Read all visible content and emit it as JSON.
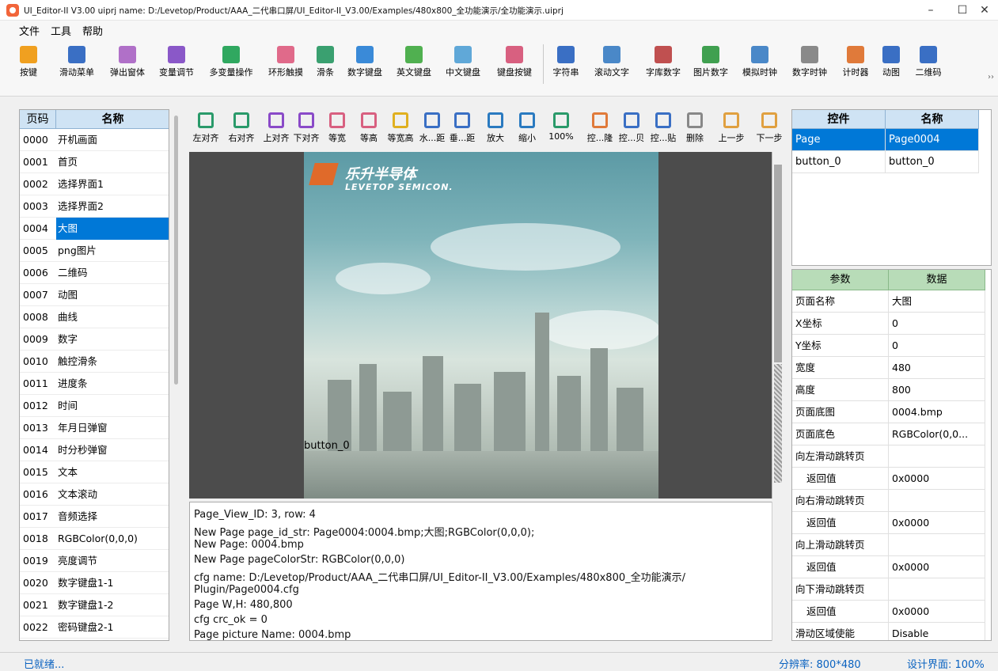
{
  "title": "UI_Editor-II V3.00  uiprj name: D:/Levetop/Product/AAA_二代串口屏/UI_Editor-II_V3.00/Examples/480x800_全功能演示/全功能演示.uiprj",
  "window_controls": {
    "minimize": "–",
    "maximize": "☐",
    "close": "✕"
  },
  "menu": [
    "文件",
    "工具",
    "帮助"
  ],
  "toolbar": [
    {
      "label": "按键",
      "color": "#f0a020"
    },
    {
      "label": "滑动菜单",
      "color": "#3a6fc4"
    },
    {
      "label": "弹出窗体",
      "color": "#b070c8"
    },
    {
      "label": "变量调节",
      "color": "#8a58c8"
    },
    {
      "label": "多变量操作",
      "color": "#30a860"
    },
    {
      "label": "环形触摸",
      "color": "#e06a8a"
    },
    {
      "label": "滑条",
      "color": "#3aa070"
    },
    {
      "label": "数字键盘",
      "color": "#3a8ad8"
    },
    {
      "label": "英文键盘",
      "color": "#50b050"
    },
    {
      "label": "中文键盘",
      "color": "#60a8d8"
    },
    {
      "label": "键盘按键",
      "color": "#d86080"
    },
    {
      "label": "字符串",
      "color": "#3a6fc4"
    },
    {
      "label": "滚动文字",
      "color": "#4a88c8"
    },
    {
      "label": "字库数字",
      "color": "#c05050"
    },
    {
      "label": "图片数字",
      "color": "#40a050"
    },
    {
      "label": "模拟时钟",
      "color": "#4a88c8"
    },
    {
      "label": "数字时钟",
      "color": "#8a8a8a"
    },
    {
      "label": "计时器",
      "color": "#e07a3a"
    },
    {
      "label": "动图",
      "color": "#3a6fc4"
    },
    {
      "label": "二维码",
      "color": "#3a6fc4"
    }
  ],
  "toolbar_more": "››",
  "pages": {
    "header": {
      "code": "页码",
      "name": "名称"
    },
    "rows": [
      {
        "num": "0000",
        "name": "开机画面"
      },
      {
        "num": "0001",
        "name": "首页"
      },
      {
        "num": "0002",
        "name": "选择界面1"
      },
      {
        "num": "0003",
        "name": "选择界面2"
      },
      {
        "num": "0004",
        "name": "大图"
      },
      {
        "num": "0005",
        "name": "png图片"
      },
      {
        "num": "0006",
        "name": "二维码"
      },
      {
        "num": "0007",
        "name": "动图"
      },
      {
        "num": "0008",
        "name": "曲线"
      },
      {
        "num": "0009",
        "name": "数字"
      },
      {
        "num": "0010",
        "name": "触控滑条"
      },
      {
        "num": "0011",
        "name": "进度条"
      },
      {
        "num": "0012",
        "name": "时间"
      },
      {
        "num": "0013",
        "name": "年月日弹窗"
      },
      {
        "num": "0014",
        "name": "时分秒弹窗"
      },
      {
        "num": "0015",
        "name": "文本"
      },
      {
        "num": "0016",
        "name": "文本滚动"
      },
      {
        "num": "0017",
        "name": "音频选择"
      },
      {
        "num": "0018",
        "name": "RGBColor(0,0,0)"
      },
      {
        "num": "0019",
        "name": "亮度调节"
      },
      {
        "num": "0020",
        "name": "数字键盘1-1"
      },
      {
        "num": "0021",
        "name": "数字键盘1-2"
      },
      {
        "num": "0022",
        "name": "密码键盘2-1"
      }
    ]
  },
  "canvas_tools": [
    {
      "label": "左对齐"
    },
    {
      "label": "右对齐"
    },
    {
      "label": "上对齐"
    },
    {
      "label": "下对齐"
    },
    {
      "label": "等宽"
    },
    {
      "label": "等高"
    },
    {
      "label": "等宽高"
    },
    {
      "label": "水...距"
    },
    {
      "label": "垂...距"
    },
    {
      "label": "放大"
    },
    {
      "label": "缩小"
    },
    {
      "label": "100%"
    },
    {
      "label": "控...隆"
    },
    {
      "label": "控...贝"
    },
    {
      "label": "控...贴"
    },
    {
      "label": "删除"
    },
    {
      "label": "上一步"
    },
    {
      "label": "下一步"
    }
  ],
  "canvas": {
    "logo_cn": "乐升半导体",
    "logo_en": "LEVETOP SEMICON.",
    "button_label": "button_0"
  },
  "log": [
    "Page_View_ID: 3, row: 4",
    "New Page page_id_str: Page0004:0004.bmp;大图;RGBColor(0,0,0);",
    "New Page: 0004.bmp",
    "New Page pageColorStr: RGBColor(0,0,0)",
    "cfg name: D:/Levetop/Product/AAA_二代串口屏/UI_Editor-II_V3.00/Examples/480x800_全功能演示/",
    "Plugin/Page0004.cfg",
    "Page W,H: 480,800",
    "cfg crc_ok = 0",
    "Page picture Name: 0004.bmp"
  ],
  "controls": {
    "header": {
      "control": "控件",
      "name": "名称"
    },
    "rows": [
      {
        "control": "Page",
        "name": "Page0004"
      },
      {
        "control": "button_0",
        "name": "button_0"
      }
    ]
  },
  "params": {
    "header": {
      "param": "参数",
      "data": "数据"
    },
    "rows": [
      {
        "param": "页面名称",
        "data": "大图"
      },
      {
        "param": "X坐标",
        "data": "0"
      },
      {
        "param": "Y坐标",
        "data": "0"
      },
      {
        "param": "宽度",
        "data": "480"
      },
      {
        "param": "高度",
        "data": "800"
      },
      {
        "param": "页面底图",
        "data": "0004.bmp"
      },
      {
        "param": "页面底色",
        "data": "RGBColor(0,0..."
      },
      {
        "param": "向左滑动跳转页",
        "data": ""
      },
      {
        "param": "返回值",
        "data": "0x0000"
      },
      {
        "param": "向右滑动跳转页",
        "data": ""
      },
      {
        "param": "返回值",
        "data": "0x0000"
      },
      {
        "param": "向上滑动跳转页",
        "data": ""
      },
      {
        "param": "返回值",
        "data": "0x0000"
      },
      {
        "param": "向下滑动跳转页",
        "data": ""
      },
      {
        "param": "返回值",
        "data": "0x0000"
      },
      {
        "param": "滑动区域使能",
        "data": "Disable"
      }
    ]
  },
  "status": {
    "left": "已就绪...",
    "resolution": "分辨率: 800*480",
    "zoom": "设计界面: 100%"
  }
}
